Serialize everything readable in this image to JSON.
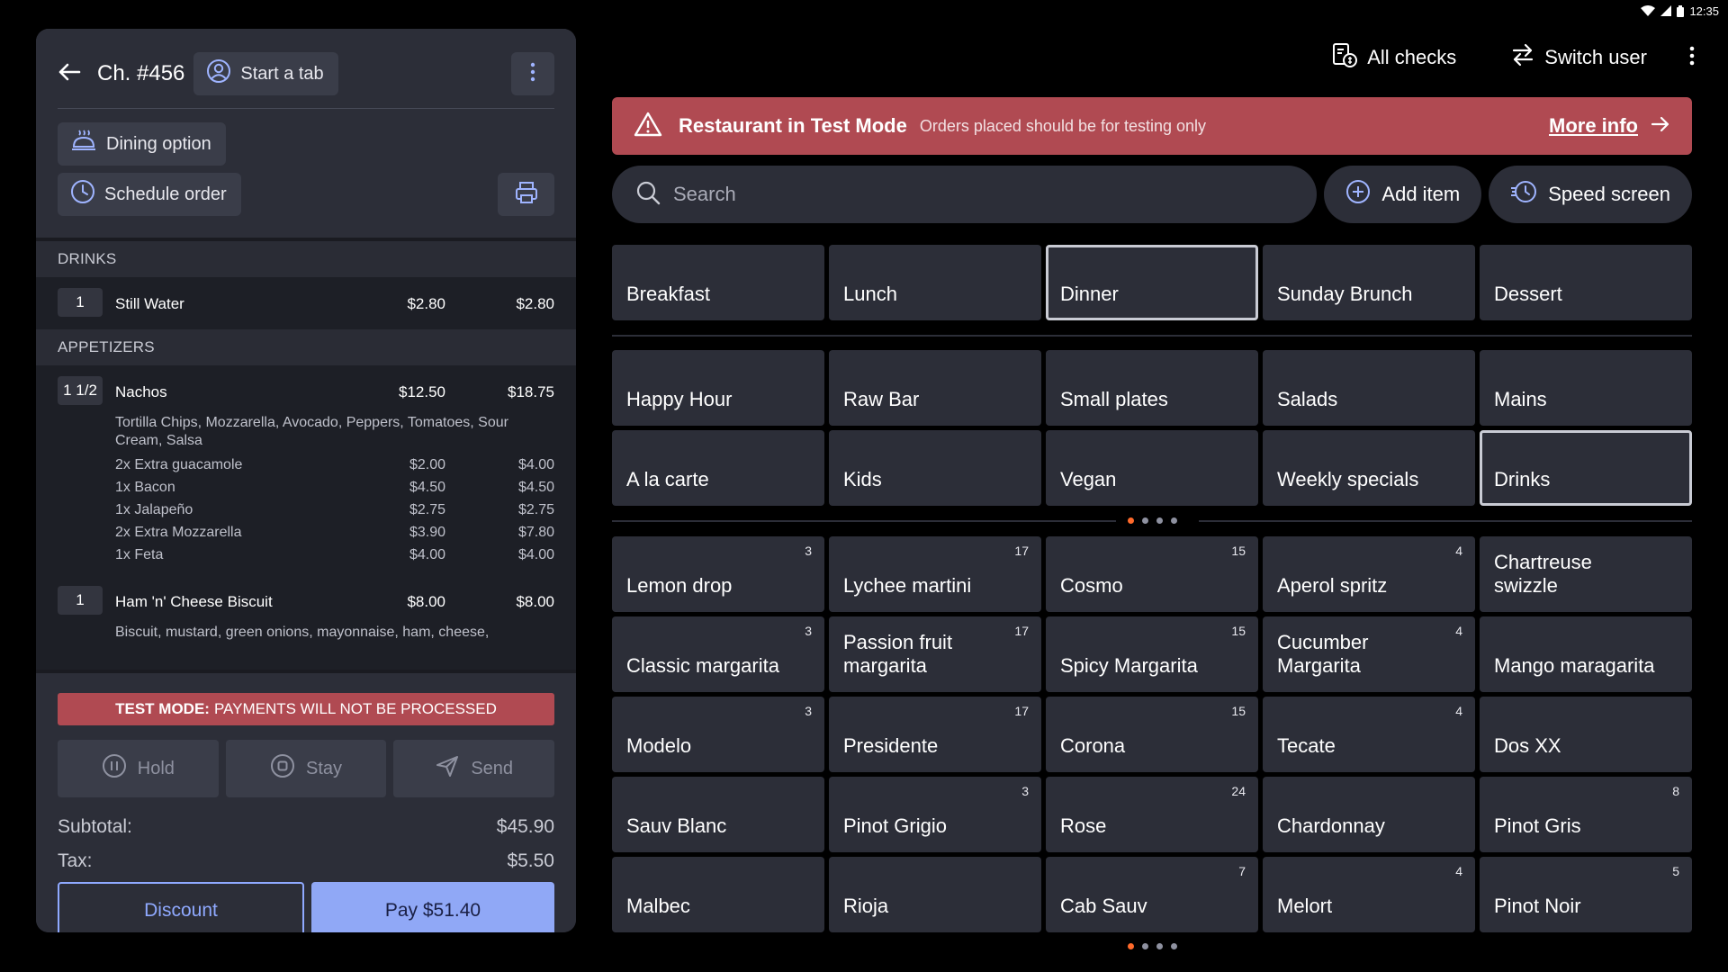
{
  "status_bar": {
    "time": "12:35"
  },
  "check": {
    "title": "Ch. #456",
    "start_tab_label": "Start a tab",
    "dining_option_label": "Dining option",
    "schedule_order_label": "Schedule order",
    "sections": [
      {
        "label": "DRINKS",
        "items": [
          {
            "qty": "1",
            "name": "Still Water",
            "price": "$2.80",
            "total": "$2.80",
            "description": "",
            "modifiers": []
          }
        ]
      },
      {
        "label": "APPETIZERS",
        "items": [
          {
            "qty": "1 1/2",
            "name": "Nachos",
            "price": "$12.50",
            "total": "$18.75",
            "description": "Tortilla Chips, Mozzarella, Avocado, Peppers, Tomatoes, Sour Cream, Salsa",
            "modifiers": [
              {
                "name": "2x Extra guacamole",
                "price": "$2.00",
                "total": "$4.00"
              },
              {
                "name": "1x Bacon",
                "price": "$4.50",
                "total": "$4.50"
              },
              {
                "name": "1x Jalapeño",
                "price": "$2.75",
                "total": "$2.75"
              },
              {
                "name": "2x Extra Mozzarella",
                "price": "$3.90",
                "total": "$7.80"
              },
              {
                "name": "1x Feta",
                "price": "$4.00",
                "total": "$4.00"
              }
            ]
          },
          {
            "qty": "1",
            "name": "Ham 'n' Cheese Biscuit",
            "price": "$8.00",
            "total": "$8.00",
            "description": "Biscuit, mustard, green onions, mayonnaise, ham, cheese,",
            "modifiers": []
          }
        ]
      }
    ],
    "test_banner_bold": "TEST MODE:",
    "test_banner_text": "PAYMENTS WILL NOT BE PROCESSED",
    "hold_label": "Hold",
    "stay_label": "Stay",
    "send_label": "Send",
    "subtotal_label": "Subtotal:",
    "subtotal_value": "$45.90",
    "tax_label": "Tax:",
    "tax_value": "$5.50",
    "discount_label": "Discount",
    "pay_label": "Pay $51.40"
  },
  "top_bar": {
    "all_checks_label": "All checks",
    "switch_user_label": "Switch user"
  },
  "mode_banner": {
    "title": "Restaurant in Test Mode",
    "subtitle": "Orders placed should be for testing only",
    "link": "More info"
  },
  "search": {
    "placeholder": "Search",
    "add_item_label": "Add item",
    "speed_screen_label": "Speed screen"
  },
  "menus": [
    {
      "label": "Breakfast",
      "selected": false
    },
    {
      "label": "Lunch",
      "selected": false
    },
    {
      "label": "Dinner",
      "selected": true
    },
    {
      "label": "Sunday Brunch",
      "selected": false
    },
    {
      "label": "Dessert",
      "selected": false
    }
  ],
  "groups": [
    {
      "label": "Happy Hour",
      "selected": false
    },
    {
      "label": "Raw Bar",
      "selected": false
    },
    {
      "label": "Small plates",
      "selected": false
    },
    {
      "label": "Salads",
      "selected": false
    },
    {
      "label": "Mains",
      "selected": false
    },
    {
      "label": "A la carte",
      "selected": false
    },
    {
      "label": "Kids",
      "selected": false
    },
    {
      "label": "Vegan",
      "selected": false
    },
    {
      "label": "Weekly specials",
      "selected": false
    },
    {
      "label": "Drinks",
      "selected": true
    }
  ],
  "group_pager": {
    "pages": 4,
    "active": 0
  },
  "items": [
    {
      "label": "Lemon drop",
      "count": "3"
    },
    {
      "label": "Lychee martini",
      "count": "17"
    },
    {
      "label": "Cosmo",
      "count": "15"
    },
    {
      "label": "Aperol spritz",
      "count": "4"
    },
    {
      "label": "Chartreuse swizzle",
      "count": ""
    },
    {
      "label": "Classic margarita",
      "count": "3"
    },
    {
      "label": "Passion fruit margarita",
      "count": "17"
    },
    {
      "label": "Spicy Margarita",
      "count": "15"
    },
    {
      "label": "Cucumber Margarita",
      "count": "4"
    },
    {
      "label": "Mango maragarita",
      "count": ""
    },
    {
      "label": "Modelo",
      "count": "3"
    },
    {
      "label": "Presidente",
      "count": "17"
    },
    {
      "label": "Corona",
      "count": "15"
    },
    {
      "label": "Tecate",
      "count": "4"
    },
    {
      "label": "Dos XX",
      "count": ""
    },
    {
      "label": "Sauv Blanc",
      "count": ""
    },
    {
      "label": "Pinot Grigio",
      "count": "3"
    },
    {
      "label": "Rose",
      "count": "24"
    },
    {
      "label": "Chardonnay",
      "count": ""
    },
    {
      "label": "Pinot Gris",
      "count": "8"
    },
    {
      "label": "Malbec",
      "count": ""
    },
    {
      "label": "Rioja",
      "count": ""
    },
    {
      "label": "Cab Sauv",
      "count": "7"
    },
    {
      "label": "Melort",
      "count": "4"
    },
    {
      "label": "Pinot Noir",
      "count": "5"
    }
  ],
  "item_pager": {
    "pages": 4,
    "active": 0
  },
  "colors": {
    "accent": "#90a8f6",
    "danger": "#b04a52",
    "page_dot": "#ff6a2b"
  }
}
